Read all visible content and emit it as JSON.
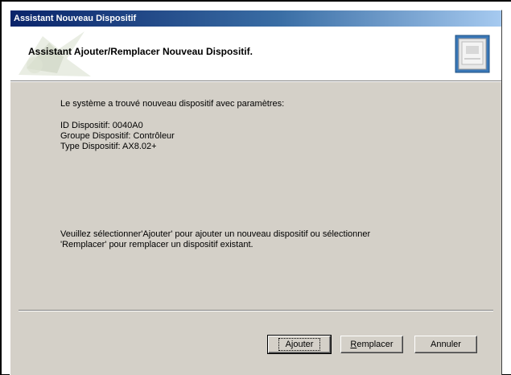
{
  "window": {
    "title": "Assistant Nouveau Dispositif"
  },
  "header": {
    "title": "Assistant Ajouter/Remplacer Nouveau Dispositif."
  },
  "content": {
    "intro": "Le système a trouvé nouveau dispositif avec paramètres:",
    "device_lines": [
      "ID Dispositif: 0040A0",
      "Groupe Dispositif: Contrôleur",
      "Type Dispositif: AX8.02+"
    ],
    "instructions_line1": "Veuillez sélectionner'Ajouter' pour ajouter un nouveau dispositif ou sélectionner",
    "instructions_line2": "'Remplacer' pour remplacer un dispositif existant."
  },
  "buttons": {
    "add": {
      "label": "Ajouter"
    },
    "replace": {
      "label_first": "R",
      "label_rest": "emplacer"
    },
    "cancel": {
      "label": "Annuler"
    }
  },
  "icons": {
    "wizard_watermark": "wizard-watermark-icon",
    "device": "device-icon"
  }
}
